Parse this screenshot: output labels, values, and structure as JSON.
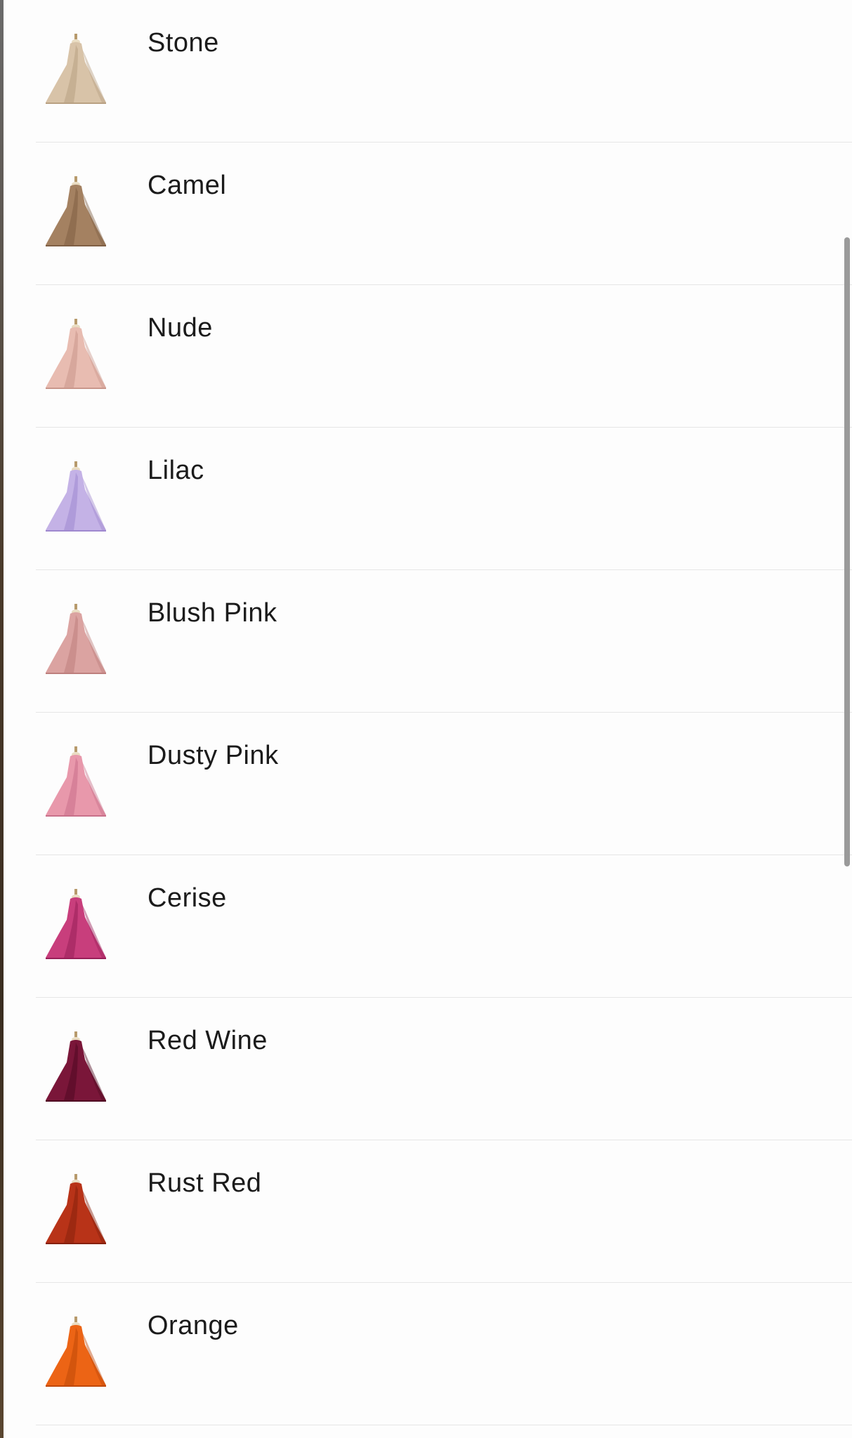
{
  "colors_list": {
    "items": [
      {
        "label": "Stone",
        "color": "#d8c3a8",
        "shade": "#b8a082"
      },
      {
        "label": "Camel",
        "color": "#a48161",
        "shade": "#7f5f44"
      },
      {
        "label": "Nude",
        "color": "#e8bcb1",
        "shade": "#c9968b"
      },
      {
        "label": "Lilac",
        "color": "#c4b2e6",
        "shade": "#9f88cf"
      },
      {
        "label": "Blush Pink",
        "color": "#dba3a1",
        "shade": "#bd7f7d"
      },
      {
        "label": "Dusty Pink",
        "color": "#e898ab",
        "shade": "#c8708a"
      },
      {
        "label": "Cerise",
        "color": "#c83e7c",
        "shade": "#981f58"
      },
      {
        "label": "Red Wine",
        "color": "#7a1639",
        "shade": "#4f0a22"
      },
      {
        "label": "Rust Red",
        "color": "#b83318",
        "shade": "#86200c"
      },
      {
        "label": "Orange",
        "color": "#ec6415",
        "shade": "#c04808"
      }
    ]
  }
}
